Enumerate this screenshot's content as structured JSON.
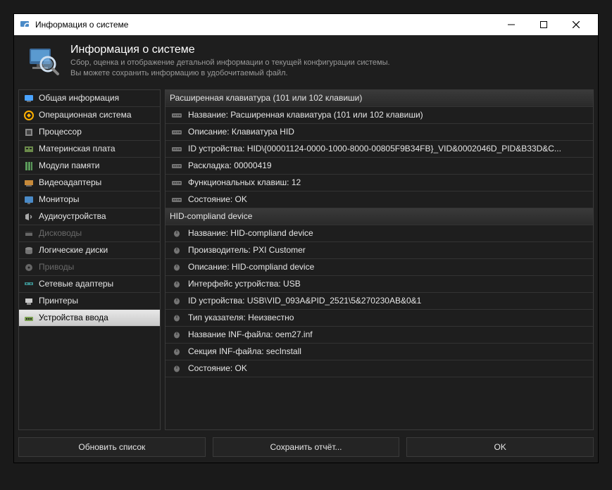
{
  "window": {
    "title": "Информация о системе"
  },
  "header": {
    "title": "Информация о системе",
    "line1": "Сбор, оценка и отображение детальной информации о текущей конфигурации системы.",
    "line2": "Вы можете сохранить информацию в удобочитаемый файл."
  },
  "sidebar": {
    "items": [
      {
        "label": "Общая информация",
        "disabled": false
      },
      {
        "label": "Операционная система",
        "disabled": false
      },
      {
        "label": "Процессор",
        "disabled": false
      },
      {
        "label": "Материнская плата",
        "disabled": false
      },
      {
        "label": "Модули памяти",
        "disabled": false
      },
      {
        "label": "Видеоадаптеры",
        "disabled": false
      },
      {
        "label": "Мониторы",
        "disabled": false
      },
      {
        "label": "Аудиоустройства",
        "disabled": false
      },
      {
        "label": "Дисководы",
        "disabled": true
      },
      {
        "label": "Логические диски",
        "disabled": false
      },
      {
        "label": "Приводы",
        "disabled": true
      },
      {
        "label": "Сетевые адаптеры",
        "disabled": false
      },
      {
        "label": "Принтеры",
        "disabled": false
      },
      {
        "label": "Устройства ввода",
        "disabled": false,
        "selected": true
      }
    ]
  },
  "details": {
    "rows": [
      {
        "type": "group",
        "text": "Расширенная клавиатура (101 или 102 клавиши)",
        "iconKind": "keyboard"
      },
      {
        "type": "item",
        "text": "Название: Расширенная клавиатура (101 или 102 клавиши)",
        "iconKind": "keyboard"
      },
      {
        "type": "item",
        "text": "Описание: Клавиатура HID",
        "iconKind": "keyboard"
      },
      {
        "type": "item",
        "text": "ID устройства: HID\\{00001124-0000-1000-8000-00805F9B34FB}_VID&0002046D_PID&B33D&C...",
        "iconKind": "keyboard"
      },
      {
        "type": "item",
        "text": "Раскладка: 00000419",
        "iconKind": "keyboard"
      },
      {
        "type": "item",
        "text": "Функциональных клавиш: 12",
        "iconKind": "keyboard"
      },
      {
        "type": "item",
        "text": "Состояние: OK",
        "iconKind": "keyboard"
      },
      {
        "type": "group",
        "text": "HID-compliand device",
        "iconKind": "mouse"
      },
      {
        "type": "item",
        "text": "Название: HID-compliand device",
        "iconKind": "mouse"
      },
      {
        "type": "item",
        "text": "Производитель: PXI Customer",
        "iconKind": "mouse"
      },
      {
        "type": "item",
        "text": "Описание: HID-compliand device",
        "iconKind": "mouse"
      },
      {
        "type": "item",
        "text": "Интерфейс устройства: USB",
        "iconKind": "mouse"
      },
      {
        "type": "item",
        "text": "ID устройства: USB\\VID_093A&PID_2521\\5&270230AB&0&1",
        "iconKind": "mouse"
      },
      {
        "type": "item",
        "text": "Тип указателя: Неизвестно",
        "iconKind": "mouse"
      },
      {
        "type": "item",
        "text": "Название INF-файла: oem27.inf",
        "iconKind": "mouse"
      },
      {
        "type": "item",
        "text": "Секция INF-файла: secInstall",
        "iconKind": "mouse"
      },
      {
        "type": "item",
        "text": "Состояние: OK",
        "iconKind": "mouse"
      }
    ]
  },
  "footer": {
    "refresh": "Обновить список",
    "save": "Сохранить отчёт...",
    "ok": "OK"
  },
  "icons": {
    "general": "#4aa3ff",
    "os": "#ffb000",
    "cpu": "#888",
    "mobo": "#6a8a4a",
    "ram": "#5a9a5a",
    "gpu": "#c78a3a",
    "monitor": "#4a8ac7",
    "audio": "#aaa",
    "drive": "#666",
    "disk": "#888",
    "optical": "#666",
    "network": "#3a8a8a",
    "printer": "#ccc",
    "input": "#7aa050"
  }
}
